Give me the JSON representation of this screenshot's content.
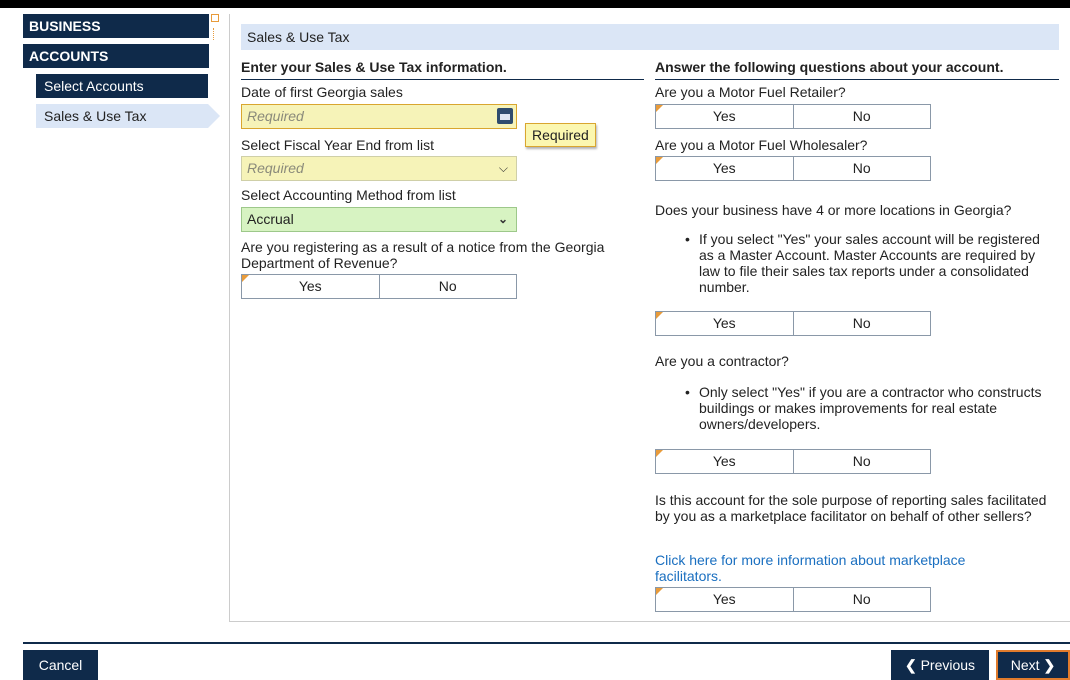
{
  "sidebar": {
    "business": "BUSINESS",
    "accounts": "ACCOUNTS",
    "items": [
      {
        "label": "Select Accounts"
      },
      {
        "label": "Sales & Use Tax"
      }
    ]
  },
  "section_title": "Sales & Use Tax",
  "left": {
    "heading": "Enter your Sales & Use Tax information.",
    "date_label": "Date of first Georgia sales",
    "date_placeholder": "Required",
    "tooltip": "Required",
    "fiscal_label": "Select Fiscal Year End from list",
    "fiscal_value": "Required",
    "accounting_label": "Select Accounting Method from list",
    "accounting_value": "Accrual",
    "notice_question": "Are you registering as a result of a notice from the Georgia Department of Revenue?"
  },
  "right": {
    "heading": "Answer the following questions about your account.",
    "q_retailer": "Are you a Motor Fuel Retailer?",
    "q_wholesaler": "Are you a Motor Fuel Wholesaler?",
    "q_locations": "Does your business have 4 or more locations in Georgia?",
    "locations_note": "If you select \"Yes\" your sales account will be registered as a Master Account. Master Accounts are required by law to file their sales tax reports under a consolidated number.",
    "q_contractor": "Are you a contractor?",
    "contractor_note": "Only select \"Yes\" if you are a contractor who constructs buildings or makes improvements for real estate owners/developers.",
    "q_marketplace": "Is this account for the sole purpose of reporting sales facilitated by you as a marketplace facilitator on behalf of other sellers?",
    "marketplace_link": "Click here for more information about marketplace facilitators."
  },
  "yes_label": "Yes",
  "no_label": "No",
  "footer": {
    "cancel": "Cancel",
    "previous": "Previous",
    "next": "Next"
  }
}
